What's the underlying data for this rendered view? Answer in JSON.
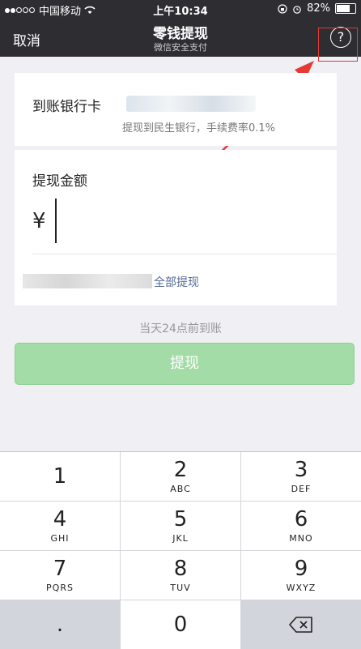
{
  "status_bar": {
    "carrier": "中国移动",
    "time": "上午10:34",
    "battery": "82%",
    "battery_level": 0.82
  },
  "nav": {
    "cancel_label": "取消",
    "title": "零钱提现",
    "subtitle": "微信安全支付",
    "help_symbol": "?"
  },
  "bank_card": {
    "label": "到账银行卡",
    "hint": "提现到民生银行，手续费率0.1%"
  },
  "amount": {
    "label": "提现金额",
    "currency_symbol": "¥",
    "withdraw_all_label": "全部提现"
  },
  "arrival_note": "当天24点前到账",
  "submit_button": {
    "label": "提现",
    "color": "#a3dca7"
  },
  "keypad": [
    {
      "num": "1",
      "letters": ""
    },
    {
      "num": "2",
      "letters": "ABC"
    },
    {
      "num": "3",
      "letters": "DEF"
    },
    {
      "num": "4",
      "letters": "GHI"
    },
    {
      "num": "5",
      "letters": "JKL"
    },
    {
      "num": "6",
      "letters": "MNO"
    },
    {
      "num": "7",
      "letters": "PQRS"
    },
    {
      "num": "8",
      "letters": "TUV"
    },
    {
      "num": "9",
      "letters": "WXYZ"
    },
    {
      "num": ".",
      "letters": ""
    },
    {
      "num": "0",
      "letters": ""
    },
    {
      "icon": "backspace-icon"
    }
  ],
  "annotation": {
    "color": "#e53935"
  }
}
